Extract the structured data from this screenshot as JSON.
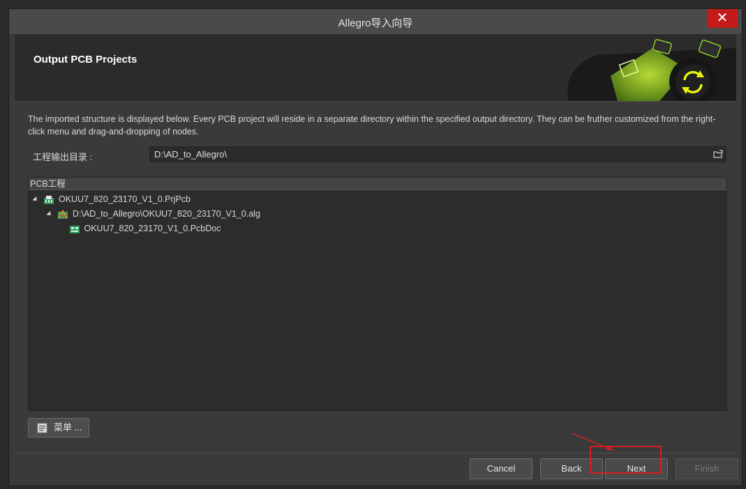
{
  "window": {
    "title": "Allegro导入向导",
    "close_label": "✕"
  },
  "header": {
    "title": "Output PCB Projects"
  },
  "description": "The imported structure is displayed below. Every PCB project will reside in a separate directory within the specified output directory. They can be fruther customized from the right-click menu and drag-and-dropping of nodes.",
  "output_dir": {
    "label": "工程输出目录 :",
    "value": "D:\\AD_to_Allegro\\"
  },
  "tree": {
    "header": "PCB工程",
    "nodes": [
      {
        "label": "OKUU7_820_23170_V1_0.PrjPcb",
        "icon": "pcb-project-icon"
      },
      {
        "label": "D:\\AD_to_Allegro\\OKUU7_820_23170_V1_0.alg",
        "icon": "allegro-file-icon"
      },
      {
        "label": "OKUU7_820_23170_V1_0.PcbDoc",
        "icon": "pcb-doc-icon"
      }
    ]
  },
  "menu_button": {
    "label": "菜单 ..."
  },
  "buttons": {
    "cancel": "Cancel",
    "back": "Back",
    "next": "Next",
    "finish": "Finish"
  },
  "colors": {
    "accent_green": "#9bd31e",
    "highlight_red": "#d42020",
    "close_red": "#c41a1a"
  }
}
